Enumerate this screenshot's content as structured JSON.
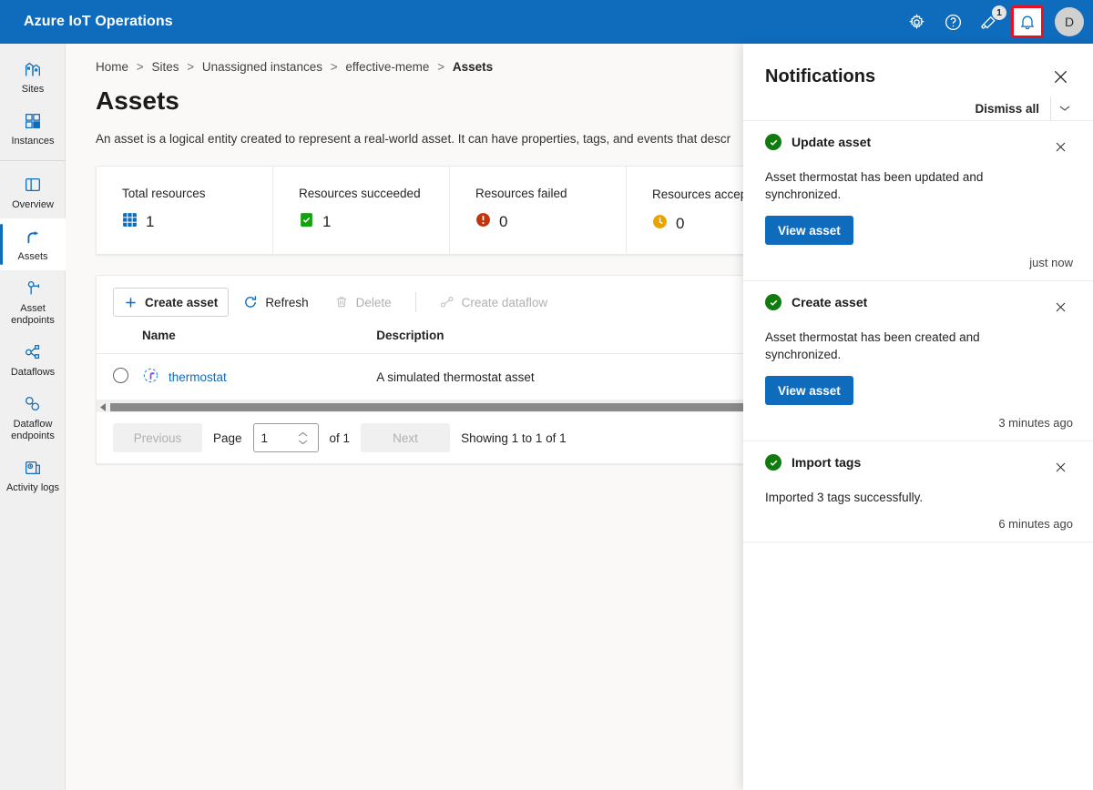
{
  "topbar": {
    "brand": "Azure IoT Operations",
    "settings_icon": "gear-icon",
    "help_icon": "question-circle-icon",
    "announcements_icon": "megaphone-icon",
    "announcements_badge": "1",
    "notifications_icon": "bell-icon",
    "avatar_initial": "D",
    "accent_color": "#0f6cbd",
    "highlight_color": "#e81123"
  },
  "sidebar": {
    "items": [
      {
        "label": "Sites",
        "icon": "sites-icon",
        "selected": false
      },
      {
        "label": "Instances",
        "icon": "instances-icon",
        "selected": false
      },
      {
        "label": "Overview",
        "icon": "overview-icon",
        "selected": false
      },
      {
        "label": "Assets",
        "icon": "assets-icon",
        "selected": true
      },
      {
        "label": "Asset endpoints",
        "icon": "asset-endpoints-icon",
        "selected": false
      },
      {
        "label": "Dataflows",
        "icon": "dataflows-icon",
        "selected": false
      },
      {
        "label": "Dataflow endpoints",
        "icon": "dataflow-endpoints-icon",
        "selected": false
      },
      {
        "label": "Activity logs",
        "icon": "activity-logs-icon",
        "selected": false
      }
    ]
  },
  "breadcrumb": {
    "items": [
      "Home",
      "Sites",
      "Unassigned instances",
      "effective-meme",
      "Assets"
    ],
    "separator": ">"
  },
  "page": {
    "title": "Assets",
    "description": "An asset is a logical entity created to represent a real-world asset. It can have properties, tags, and events that descr"
  },
  "stats": [
    {
      "label": "Total resources",
      "value": "1",
      "icon": "grid-icon",
      "color": "#0f6cbd",
      "info": false
    },
    {
      "label": "Resources succeeded",
      "value": "1",
      "icon": "success-icon",
      "color": "#13a10e",
      "info": false
    },
    {
      "label": "Resources failed",
      "value": "0",
      "icon": "error-icon",
      "color": "#d13438",
      "info": false
    },
    {
      "label": "Resources accepted",
      "value": "0",
      "icon": "pending-icon",
      "color": "#eaa300",
      "info": true
    }
  ],
  "toolbar": {
    "create_asset": "Create asset",
    "refresh": "Refresh",
    "delete": "Delete",
    "create_dataflow": "Create dataflow"
  },
  "table": {
    "columns": [
      "Name",
      "Description"
    ],
    "rows": [
      {
        "name": "thermostat",
        "description": "A simulated thermostat asset",
        "icon": "asset-icon"
      }
    ]
  },
  "pagination": {
    "previous": "Previous",
    "page_label": "Page",
    "page_value": "1",
    "of_label": "of 1",
    "next": "Next",
    "showing": "Showing 1 to 1 of 1"
  },
  "notifications_panel": {
    "title": "Notifications",
    "close_icon": "close-icon",
    "dismiss_all": "Dismiss all",
    "collapse_icon": "chevron-down-icon",
    "items": [
      {
        "title": "Update asset",
        "status_icon": "success-check-icon",
        "body": "Asset thermostat has been updated and synchronized.",
        "action": "View asset",
        "time": "just now",
        "dismiss_icon": "close-icon"
      },
      {
        "title": "Create asset",
        "status_icon": "success-check-icon",
        "body": "Asset thermostat has been created and synchronized.",
        "action": "View asset",
        "time": "3 minutes ago",
        "dismiss_icon": "close-icon"
      },
      {
        "title": "Import tags",
        "status_icon": "success-check-icon",
        "body": "Imported 3 tags successfully.",
        "action": null,
        "time": "6 minutes ago",
        "dismiss_icon": "close-icon"
      }
    ]
  }
}
